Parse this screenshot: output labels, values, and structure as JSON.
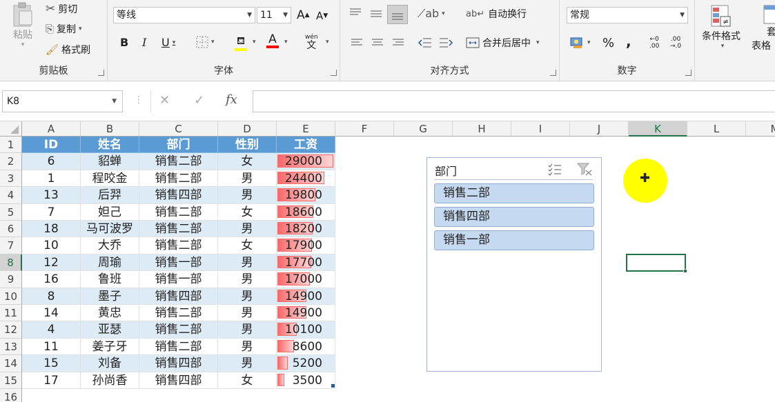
{
  "ribbon": {
    "clipboard": {
      "label": "剪贴板",
      "paste": "粘贴",
      "cut": "剪切",
      "copy": "复制",
      "painter": "格式刷"
    },
    "font": {
      "label": "字体",
      "name": "等线",
      "size": "11",
      "bold": "B",
      "italic": "I",
      "underline": "U",
      "grow": "A",
      "shrink": "A",
      "font_color_letter": "A",
      "phonetic_top": "wén",
      "phonetic_bottom": "文"
    },
    "alignment": {
      "label": "对齐方式",
      "wrap": "自动换行",
      "merge": "合并后居中"
    },
    "number": {
      "label": "数字",
      "format": "常规",
      "percent": "%",
      "comma": ",",
      "inc_decimal": ".00",
      "dec_decimal": ".00"
    },
    "styles": {
      "conditional": "条件格式",
      "table_top": "套",
      "table_bottom": "表格"
    }
  },
  "formula_bar": {
    "name_box": "K8",
    "fx": "fx",
    "cancel": "✕",
    "confirm": "✓"
  },
  "columns": [
    "A",
    "B",
    "C",
    "D",
    "E",
    "F",
    "G",
    "H",
    "I",
    "J",
    "K",
    "L",
    "M"
  ],
  "rows": [
    "1",
    "2",
    "3",
    "4",
    "5",
    "6",
    "7",
    "8",
    "9",
    "10",
    "11",
    "12",
    "13",
    "14",
    "15",
    "16"
  ],
  "table": {
    "headers": [
      "ID",
      "姓名",
      "部门",
      "性别",
      "工资"
    ],
    "max_salary": 29000,
    "rows": [
      [
        "6",
        "貂蝉",
        "销售二部",
        "女",
        "29000"
      ],
      [
        "1",
        "程咬金",
        "销售二部",
        "男",
        "24400"
      ],
      [
        "13",
        "后羿",
        "销售四部",
        "男",
        "19800"
      ],
      [
        "7",
        "妲己",
        "销售二部",
        "女",
        "18600"
      ],
      [
        "18",
        "马可波罗",
        "销售二部",
        "男",
        "18200"
      ],
      [
        "10",
        "大乔",
        "销售二部",
        "女",
        "17900"
      ],
      [
        "12",
        "周瑜",
        "销售一部",
        "男",
        "17700"
      ],
      [
        "16",
        "鲁班",
        "销售一部",
        "男",
        "17000"
      ],
      [
        "8",
        "墨子",
        "销售四部",
        "男",
        "14900"
      ],
      [
        "14",
        "黄忠",
        "销售二部",
        "男",
        "14900"
      ],
      [
        "4",
        "亚瑟",
        "销售二部",
        "男",
        "10100"
      ],
      [
        "11",
        "姜子牙",
        "销售二部",
        "男",
        "8600"
      ],
      [
        "15",
        "刘备",
        "销售四部",
        "男",
        "5200"
      ],
      [
        "17",
        "孙尚香",
        "销售四部",
        "女",
        "3500"
      ]
    ]
  },
  "slicer": {
    "title": "部门",
    "items": [
      "销售二部",
      "销售四部",
      "销售一部"
    ]
  },
  "selected_cell": "K8",
  "colors": {
    "header_fill": "#5b9bd5",
    "band_fill": "#ddebf7",
    "databar": "#f8696b",
    "slicer_item": "#c5d9f1",
    "cursor_highlight": "#ffff00",
    "selection": "#217346"
  }
}
